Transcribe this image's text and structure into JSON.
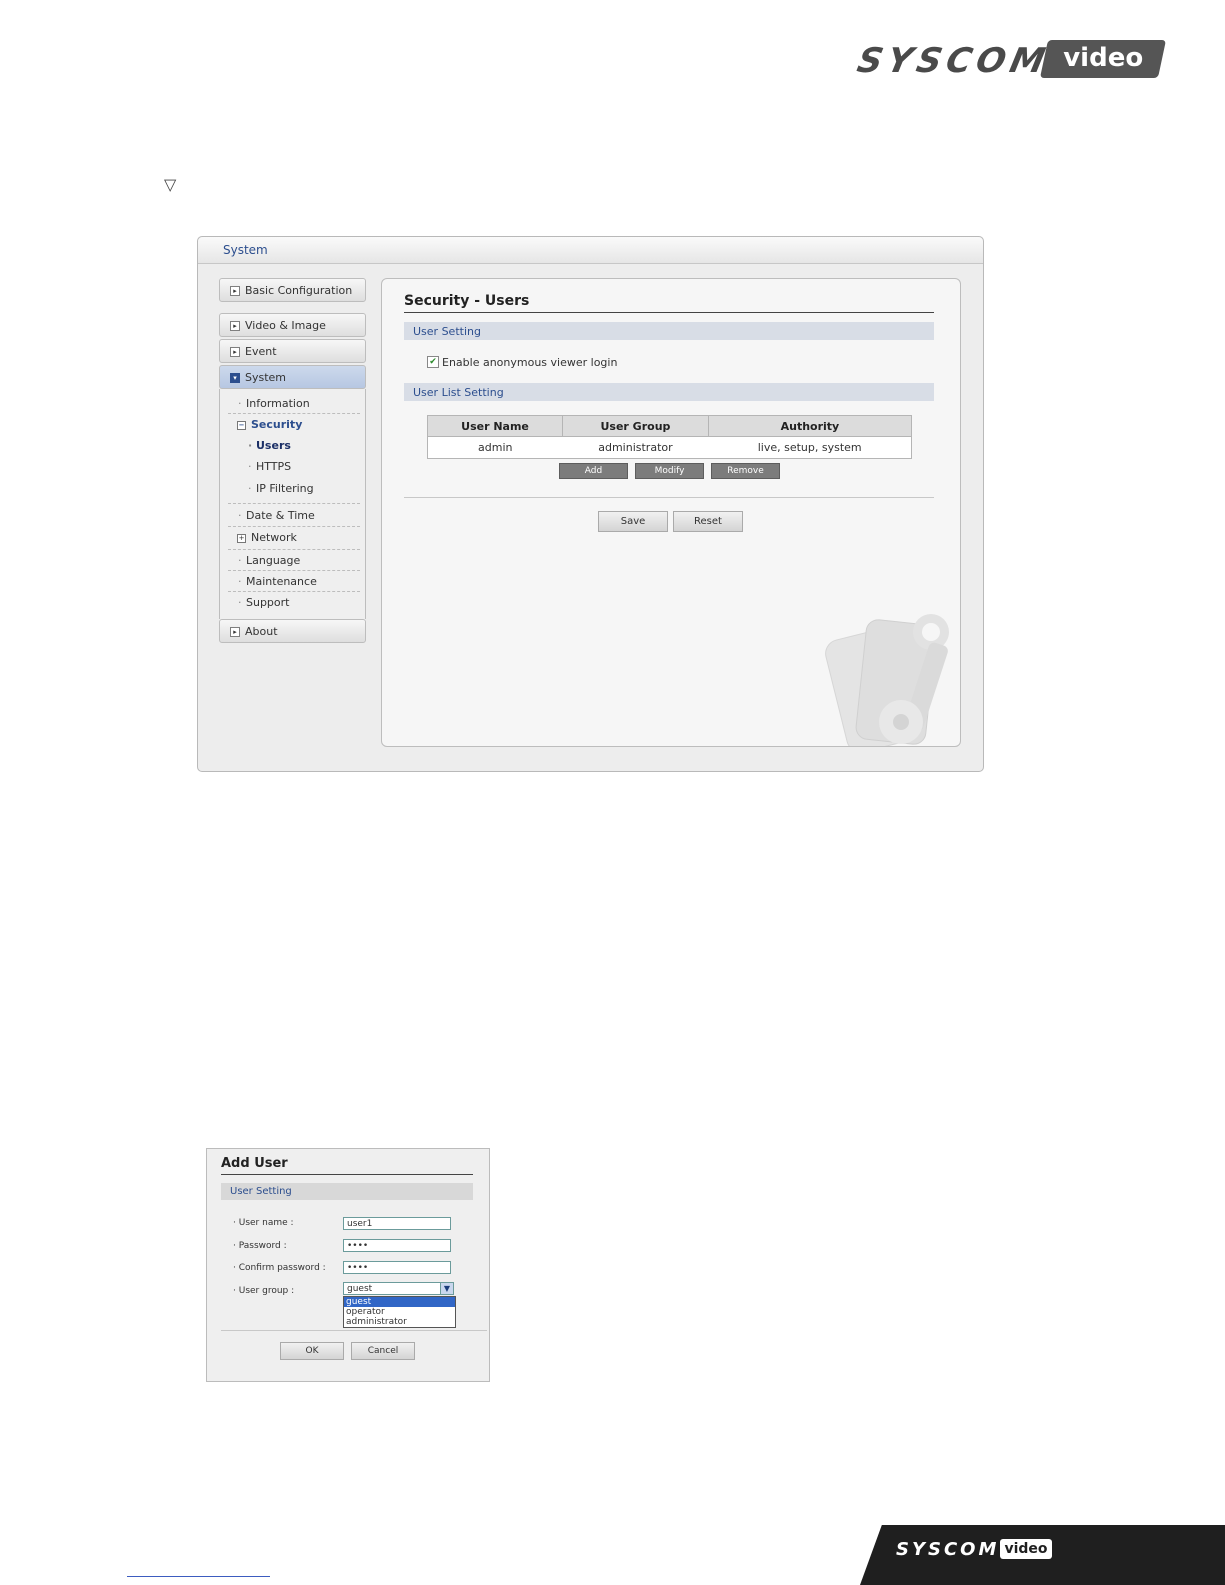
{
  "brand": {
    "name": "SYSCOM",
    "badge": "video"
  },
  "window": {
    "title": "System"
  },
  "sidebar": {
    "basic_configuration": "Basic Configuration",
    "video_image": "Video & Image",
    "event": "Event",
    "system": "System",
    "about": "About",
    "sub_items": {
      "information": "Information",
      "security": "Security",
      "users": "Users",
      "https": "HTTPS",
      "ip_filtering": "IP Filtering",
      "date_time": "Date & Time",
      "network": "Network",
      "language": "Language",
      "maintenance": "Maintenance",
      "support": "Support"
    }
  },
  "main": {
    "title": "Security - Users",
    "user_setting_header": "User Setting",
    "anonymous_label": "Enable anonymous viewer login",
    "anonymous_checked": true,
    "user_list_header": "User List Setting",
    "table": {
      "headers": [
        "User Name",
        "User Group",
        "Authority"
      ],
      "rows": [
        [
          "admin",
          "administrator",
          "live, setup, system"
        ]
      ]
    },
    "buttons": {
      "add": "Add",
      "modify": "Modify",
      "remove": "Remove",
      "save": "Save",
      "reset": "Reset"
    }
  },
  "add_user_dialog": {
    "title": "Add User",
    "section": "User Setting",
    "user_name_label": "User name :",
    "user_name_value": "user1",
    "password_label": "Password :",
    "password_value": "••••",
    "confirm_label": "Confirm password :",
    "confirm_value": "••••",
    "group_label": "User group :",
    "group_value": "guest",
    "group_options": [
      "guest",
      "operator",
      "administrator"
    ],
    "ok": "OK",
    "cancel": "Cancel"
  }
}
